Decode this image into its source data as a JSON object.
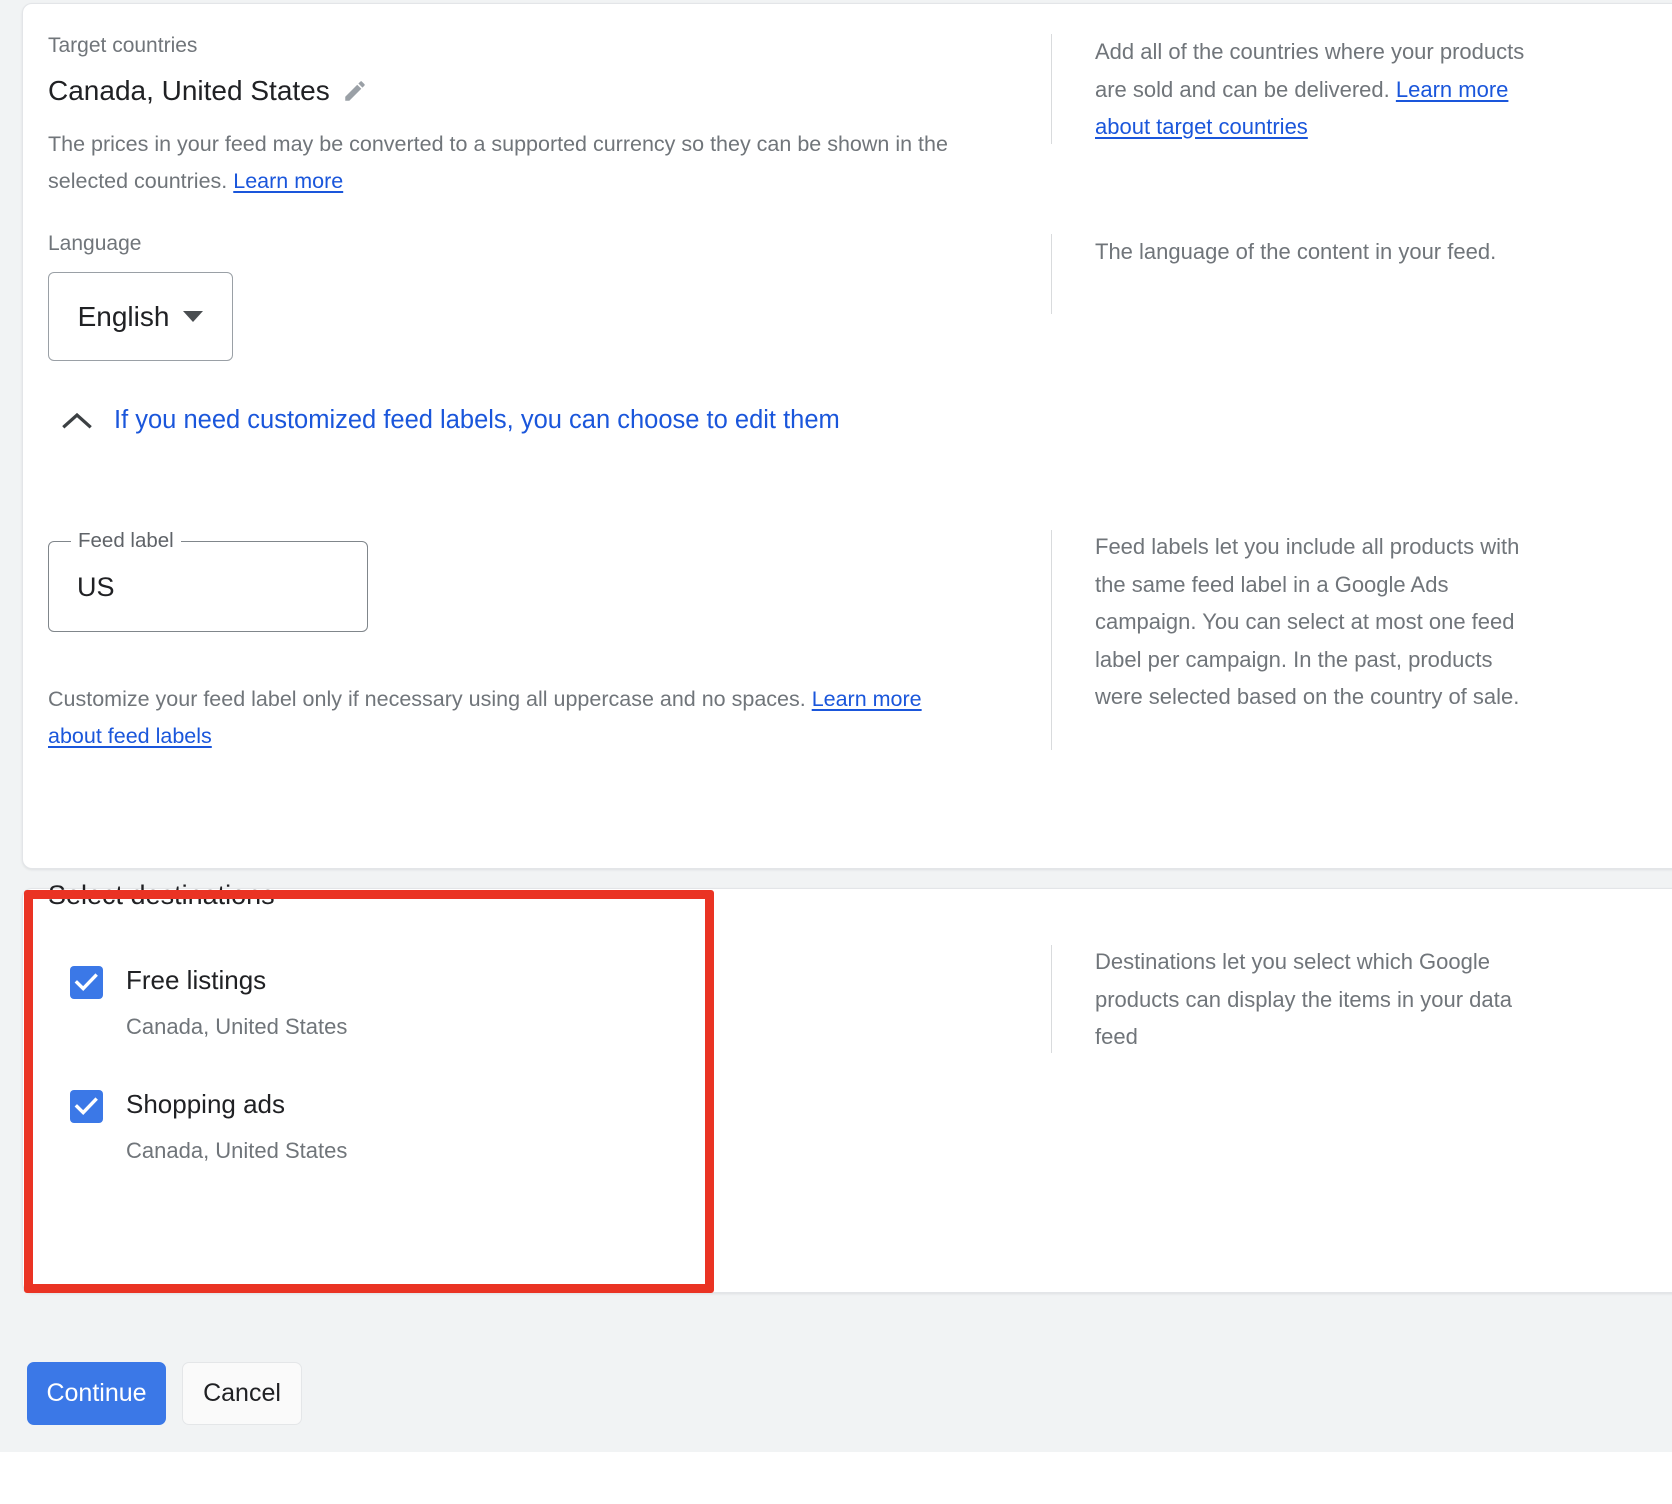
{
  "settings_card": {
    "target_countries": {
      "label": "Target countries",
      "value": "Canada, United States",
      "edit_icon": "pencil-icon",
      "helper_text": "The prices in your feed may be converted to a supported currency so they can be shown in the selected countries. ",
      "helper_link": "Learn more",
      "side_text": "Add all of the countries where your products are sold and can be delivered. ",
      "side_link": "Learn more about target countries"
    },
    "language": {
      "label": "Language",
      "selected": "English",
      "dropdown_icon": "chevron-down-icon",
      "side_text": "The language of the content in your feed."
    },
    "expander": {
      "icon": "chevron-up-icon",
      "text": "If you need customized feed labels, you can choose to edit them"
    },
    "feed_label": {
      "field_label": "Feed label",
      "value": "US",
      "helper_text": "Customize your feed label only if necessary using all uppercase and no spaces. ",
      "helper_link": "Learn more about feed labels",
      "side_text": "Feed labels let you include all products with the same feed label in a Google Ads campaign. You can select at most one feed label per campaign. In the past, products were selected based on the country of sale."
    }
  },
  "destinations_card": {
    "title": "Select destinations",
    "items": [
      {
        "label": "Free listings",
        "sublabel": "Canada, United States",
        "checked": true
      },
      {
        "label": "Shopping ads",
        "sublabel": "Canada, United States",
        "checked": true
      }
    ],
    "side_text": "Destinations let you select which Google products can display the items in your data feed"
  },
  "footer": {
    "continue_label": "Continue",
    "cancel_label": "Cancel"
  },
  "annotation": {
    "color": "#ea3323"
  },
  "colors": {
    "accent_blue": "#3b78e7",
    "link_blue": "#1a56db",
    "checkbox_blue": "#3b78e7",
    "text_primary": "#202124",
    "text_secondary": "#70757a",
    "page_background": "#f1f3f4",
    "card_background": "#ffffff"
  }
}
